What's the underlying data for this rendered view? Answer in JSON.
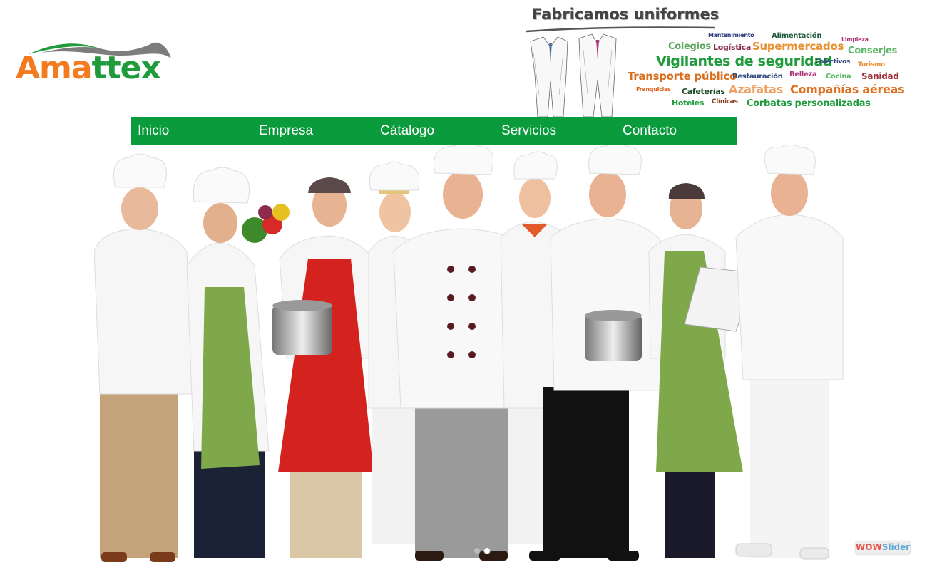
{
  "logo": {
    "part1": "Ama",
    "part2": "ttex",
    "colors": {
      "orange": "#f47a20",
      "green": "#1f9b3b",
      "grey": "#7d7d7d"
    }
  },
  "banner": {
    "title": "Fabricamos uniformes",
    "words": {
      "mantenimiento": "Mantenimiento",
      "alimentacion": "Alimentación",
      "limpieza": "Limpieza",
      "colegios": "Colegios",
      "logistica": "Logística",
      "supermercados": "Supermercados",
      "conserjes": "Conserjes",
      "vigilantes": "Vigilantes de seguridad",
      "colectivos": "Colectivos",
      "turismo": "Turismo",
      "transporte": "Transporte público",
      "restauracion": "Restauración",
      "belleza": "Belleza",
      "cocina": "Cocina",
      "sanidad": "Sanidad",
      "franquicias": "Franquicias",
      "cafeterias": "Cafeterías",
      "azafatas": "Azafatas",
      "companias": "Compañías aéreas",
      "hoteles": "Hoteles",
      "clinicas": "Clínicas",
      "corbatas": "Corbatas personalizadas"
    }
  },
  "nav": {
    "items": [
      "Inicio",
      "Empresa",
      "Cátalogo",
      "Servicios",
      "Contacto"
    ],
    "color": "#0a9b3c"
  },
  "slider": {
    "bullets": 2,
    "active_bullet": 1,
    "credit_part1": "WOW",
    "credit_part2": "Slider"
  }
}
